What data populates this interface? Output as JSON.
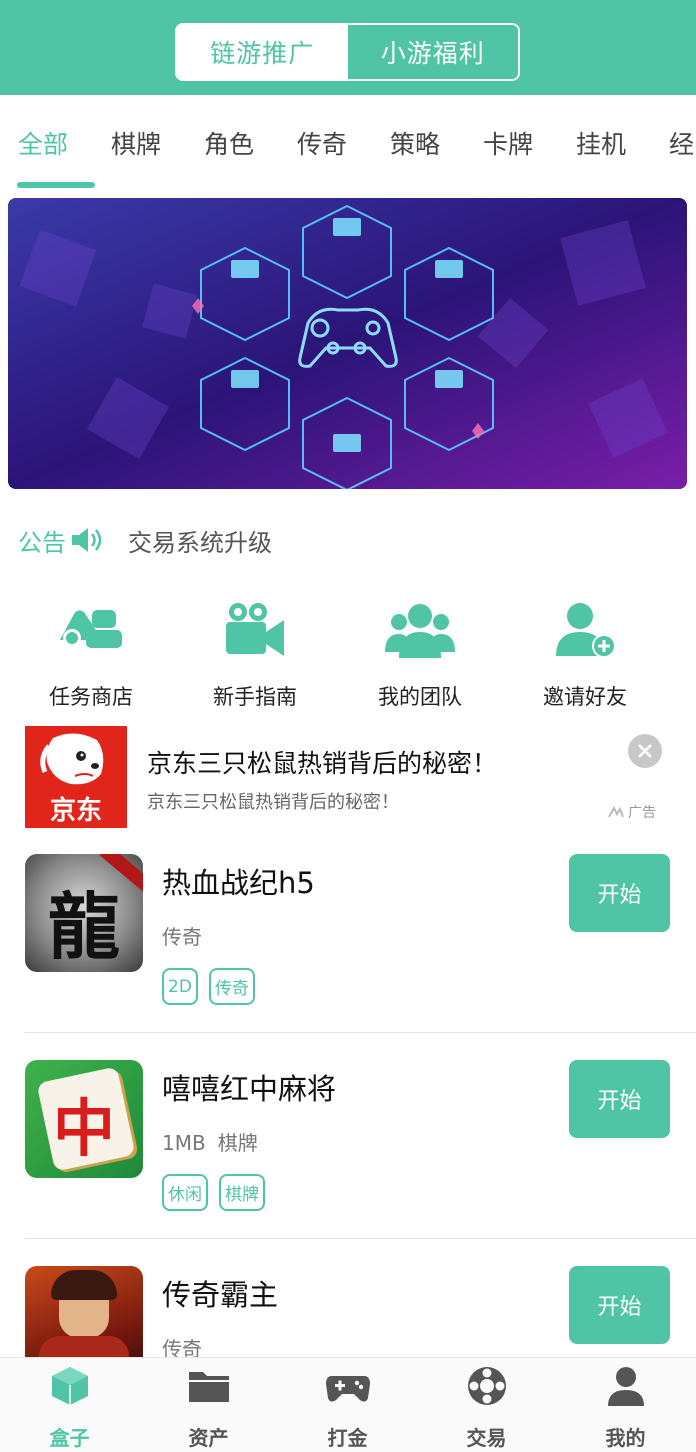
{
  "header": {
    "tabs": [
      "链游推广",
      "小游福利"
    ],
    "active_tab": 0
  },
  "categories": [
    "全部",
    "棋牌",
    "角色",
    "传奇",
    "策略",
    "卡牌",
    "挂机",
    "经"
  ],
  "notice": {
    "label": "公告",
    "text": "交易系统升级"
  },
  "quick_entries": [
    {
      "label": "任务商店",
      "icon": "task-store-icon"
    },
    {
      "label": "新手指南",
      "icon": "video-guide-icon"
    },
    {
      "label": "我的团队",
      "icon": "team-icon"
    },
    {
      "label": "邀请好友",
      "icon": "invite-friend-icon"
    }
  ],
  "ad": {
    "logo_text": "京东",
    "title": "京东三只松鼠热销背后的秘密！",
    "subtitle": "京东三只松鼠热销背后的秘密！",
    "tag": "广告"
  },
  "games": [
    {
      "name": "热血战纪h5",
      "size": "",
      "genre": "传奇",
      "tags": [
        "2D",
        "传奇"
      ],
      "button": "开始",
      "icon_text": "龍"
    },
    {
      "name": "嘻嘻红中麻将",
      "size": "1MB",
      "genre": "棋牌",
      "tags": [
        "休闲",
        "棋牌"
      ],
      "button": "开始",
      "icon_text": "中"
    },
    {
      "name": "传奇霸主",
      "size": "",
      "genre": "传奇",
      "tags": [],
      "button": "开始",
      "icon_text": ""
    }
  ],
  "bottom_nav": [
    {
      "label": "盒子",
      "icon": "cube-icon"
    },
    {
      "label": "资产",
      "icon": "folder-icon"
    },
    {
      "label": "打金",
      "icon": "gamepad-icon"
    },
    {
      "label": "交易",
      "icon": "trade-icon"
    },
    {
      "label": "我的",
      "icon": "user-icon"
    }
  ],
  "active_nav": 0,
  "colors": {
    "accent": "#4fc5a5",
    "jd_red": "#e1251b"
  }
}
